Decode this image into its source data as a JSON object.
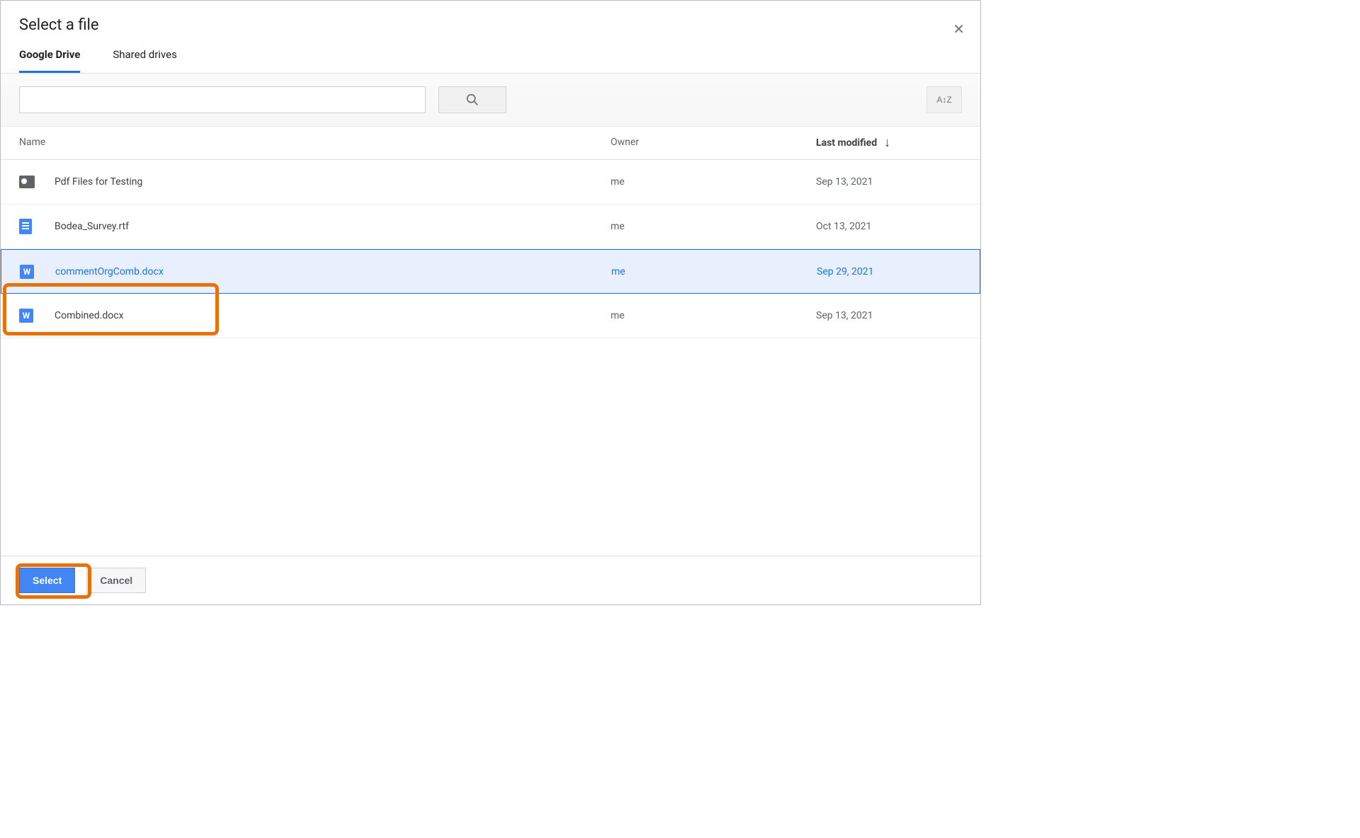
{
  "dialog": {
    "title": "Select a file"
  },
  "tabs": {
    "gdrive": "Google Drive",
    "shared": "Shared drives"
  },
  "columns": {
    "name": "Name",
    "owner": "Owner",
    "modified": "Last modified"
  },
  "rows": [
    {
      "icon": "folder",
      "name": "Pdf Files for Testing",
      "owner": "me",
      "modified": "Sep 13, 2021",
      "selected": false
    },
    {
      "icon": "doc",
      "name": "Bodea_Survey.rtf",
      "owner": "me",
      "modified": "Oct 13, 2021",
      "selected": false
    },
    {
      "icon": "word",
      "name": "commentOrgComb.docx",
      "owner": "me",
      "modified": "Sep 29, 2021",
      "selected": true
    },
    {
      "icon": "word",
      "name": "Combined.docx",
      "owner": "me",
      "modified": "Sep 13, 2021",
      "selected": false
    }
  ],
  "buttons": {
    "select": "Select",
    "cancel": "Cancel"
  },
  "word_glyph": "W"
}
